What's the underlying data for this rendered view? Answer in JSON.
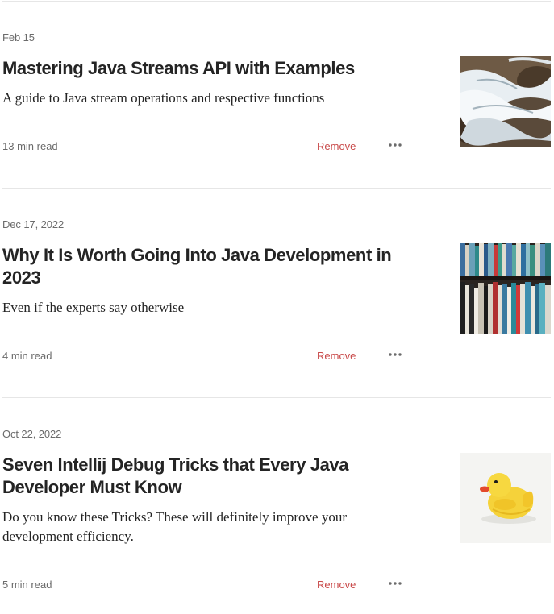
{
  "articles": [
    {
      "date": "Feb 15",
      "title": "Mastering Java Streams API with Examples",
      "subtitle": "A guide to Java stream operations and respective functions",
      "read_time": "13 min read",
      "remove_label": "Remove",
      "more_icon": "more-horizontal-icon",
      "thumbnail": "water-stream-image"
    },
    {
      "date": "Dec 17, 2022",
      "title": "Why It Is Worth Going Into Java Development in 2023",
      "subtitle": "Even if the experts say otherwise",
      "read_time": "4 min read",
      "remove_label": "Remove",
      "more_icon": "more-horizontal-icon",
      "thumbnail": "bookshelf-image"
    },
    {
      "date": "Oct 22, 2022",
      "title": "Seven Intellij Debug Tricks that Every Java Developer Must Know",
      "subtitle": "Do you know these Tricks? These will definitely improve your development efficiency.",
      "read_time": "5 min read",
      "remove_label": "Remove",
      "more_icon": "more-horizontal-icon",
      "thumbnail": "rubber-duck-image"
    }
  ],
  "colors": {
    "text": "#242424",
    "meta": "#6b6b6b",
    "remove": "#c94a4a",
    "divider": "#e6e6e6"
  }
}
